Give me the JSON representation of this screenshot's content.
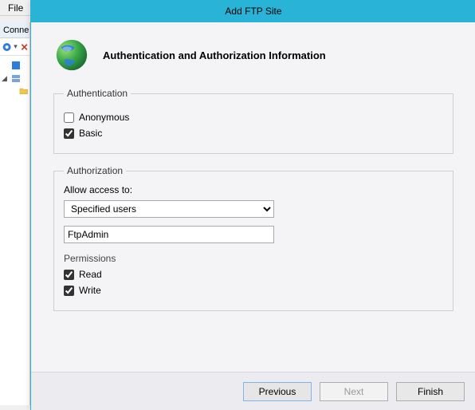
{
  "bg": {
    "menu_file": "File",
    "connections_label": "Conne"
  },
  "dialog": {
    "title": "Add FTP Site",
    "page_heading": "Authentication and Authorization Information",
    "authentication": {
      "group_label": "Authentication",
      "anonymous": {
        "label": "Anonymous",
        "checked": false
      },
      "basic": {
        "label": "Basic",
        "checked": true
      }
    },
    "authorization": {
      "group_label": "Authorization",
      "allow_access_label": "Allow access to:",
      "access_mode": "Specified users",
      "user_value": "FtpAdmin",
      "permissions_label": "Permissions",
      "read": {
        "label": "Read",
        "checked": true
      },
      "write": {
        "label": "Write",
        "checked": true
      }
    },
    "buttons": {
      "previous": "Previous",
      "next": "Next",
      "finish": "Finish"
    }
  }
}
